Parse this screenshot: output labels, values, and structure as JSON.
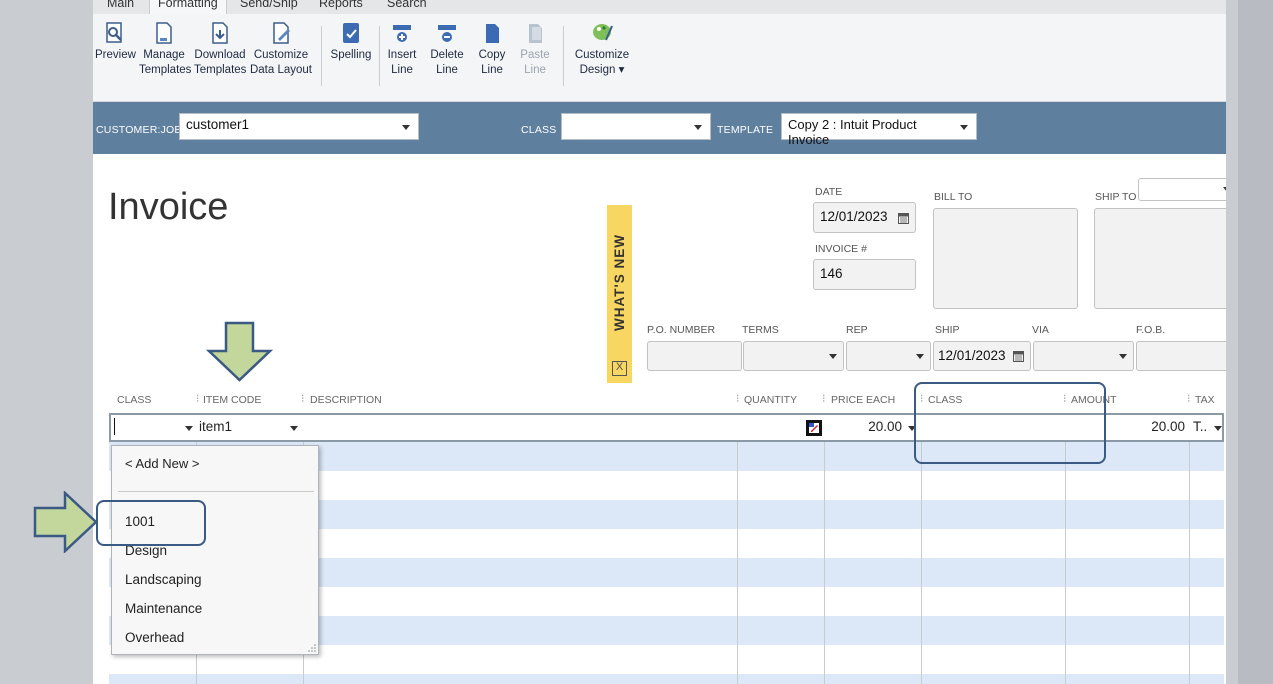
{
  "tabs": [
    "Main",
    "Formatting",
    "Send/Ship",
    "Reports",
    "Search"
  ],
  "toolbar": {
    "preview": "Preview",
    "manage_templates": [
      "Manage",
      "Templates"
    ],
    "download_templates": [
      "Download",
      "Templates"
    ],
    "customize_data_layout": [
      "Customize",
      "Data Layout"
    ],
    "spelling": "Spelling",
    "insert_line": [
      "Insert",
      "Line"
    ],
    "delete_line": [
      "Delete",
      "Line"
    ],
    "copy_line": [
      "Copy",
      "Line"
    ],
    "paste_line": [
      "Paste",
      "Line"
    ],
    "customize_design": [
      "Customize",
      "Design ▾"
    ]
  },
  "header": {
    "customer_job_label": "CUSTOMER:JOB",
    "customer_job_value": "customer1",
    "class_label": "CLASS",
    "class_value": "",
    "template_label": "TEMPLATE",
    "template_value": "Copy 2 : Intuit Product Invoice"
  },
  "form": {
    "title": "Invoice",
    "date_label": "DATE",
    "date_value": "12/01/2023",
    "invoice_no_label": "INVOICE #",
    "invoice_no_value": "146",
    "bill_to_label": "BILL TO",
    "ship_to_label": "SHIP TO",
    "whats_new": "WHAT'S NEW",
    "whats_new_close": "X",
    "po_number_label": "P.O. NUMBER",
    "terms_label": "TERMS",
    "rep_label": "REP",
    "ship_label": "SHIP",
    "ship_value": "12/01/2023",
    "via_label": "VIA",
    "fob_label": "F.O.B."
  },
  "grid": {
    "columns": [
      "CLASS",
      "ITEM CODE",
      "DESCRIPTION",
      "QUANTITY",
      "PRICE EACH",
      "CLASS",
      "AMOUNT",
      "TAX"
    ],
    "row": {
      "class": "",
      "item_code": "item1",
      "description": "",
      "quantity": "",
      "price_each": "20.00",
      "class2": "",
      "amount": "20.00",
      "tax": "T.."
    }
  },
  "class_dropdown": {
    "add_new": "< Add New >",
    "options": [
      "1001",
      "Design",
      "Landscaping",
      "Maintenance",
      "Overhead"
    ]
  },
  "colors": {
    "header_bar": "#5f7f9f",
    "stripe": "#dce8f7",
    "whats_new": "#f7d761",
    "callout": "#3a5a84",
    "arrow_fill": "#c3d69b"
  }
}
